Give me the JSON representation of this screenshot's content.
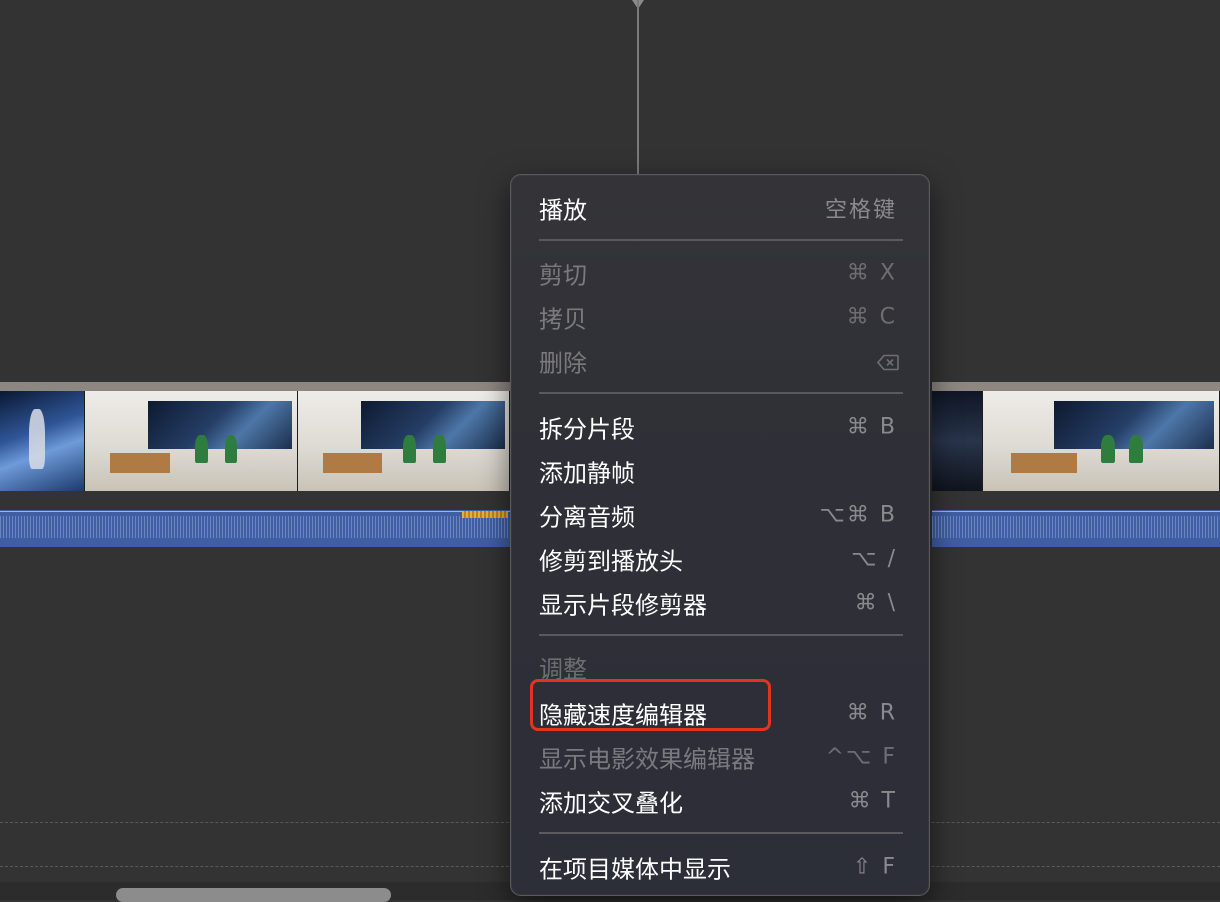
{
  "context_menu": {
    "items": [
      {
        "label": "播放",
        "shortcut": "空格键",
        "enabled": true
      },
      {
        "label": "剪切",
        "shortcut": "⌘ X",
        "enabled": false
      },
      {
        "label": "拷贝",
        "shortcut": "⌘ C",
        "enabled": false
      },
      {
        "label": "删除",
        "shortcut_icon": "delete-backward-icon",
        "enabled": false
      },
      {
        "label": "拆分片段",
        "shortcut": "⌘ B",
        "enabled": true
      },
      {
        "label": "添加静帧",
        "shortcut": "",
        "enabled": true
      },
      {
        "label": "分离音频",
        "shortcut": "⌥⌘ B",
        "enabled": true
      },
      {
        "label": "修剪到播放头",
        "shortcut": "⌥ /",
        "enabled": true
      },
      {
        "label": "显示片段修剪器",
        "shortcut": "⌘ \\",
        "enabled": true
      },
      {
        "label": "调整",
        "section_header": true
      },
      {
        "label": "隐藏速度编辑器",
        "shortcut": "⌘ R",
        "enabled": true,
        "highlighted": true
      },
      {
        "label": "显示电影效果编辑器",
        "shortcut": "^⌥ F",
        "enabled": false
      },
      {
        "label": "添加交叉叠化",
        "shortcut": "⌘ T",
        "enabled": true
      },
      {
        "label": "在项目媒体中显示",
        "shortcut": "⇧ F",
        "enabled": true
      }
    ]
  },
  "colors": {
    "background": "#333333",
    "audio_waveform": "#3f5ea3",
    "highlight_box": "#e0351f",
    "menu_text": "#ffffff",
    "disabled_text": "#7a7a7e"
  }
}
